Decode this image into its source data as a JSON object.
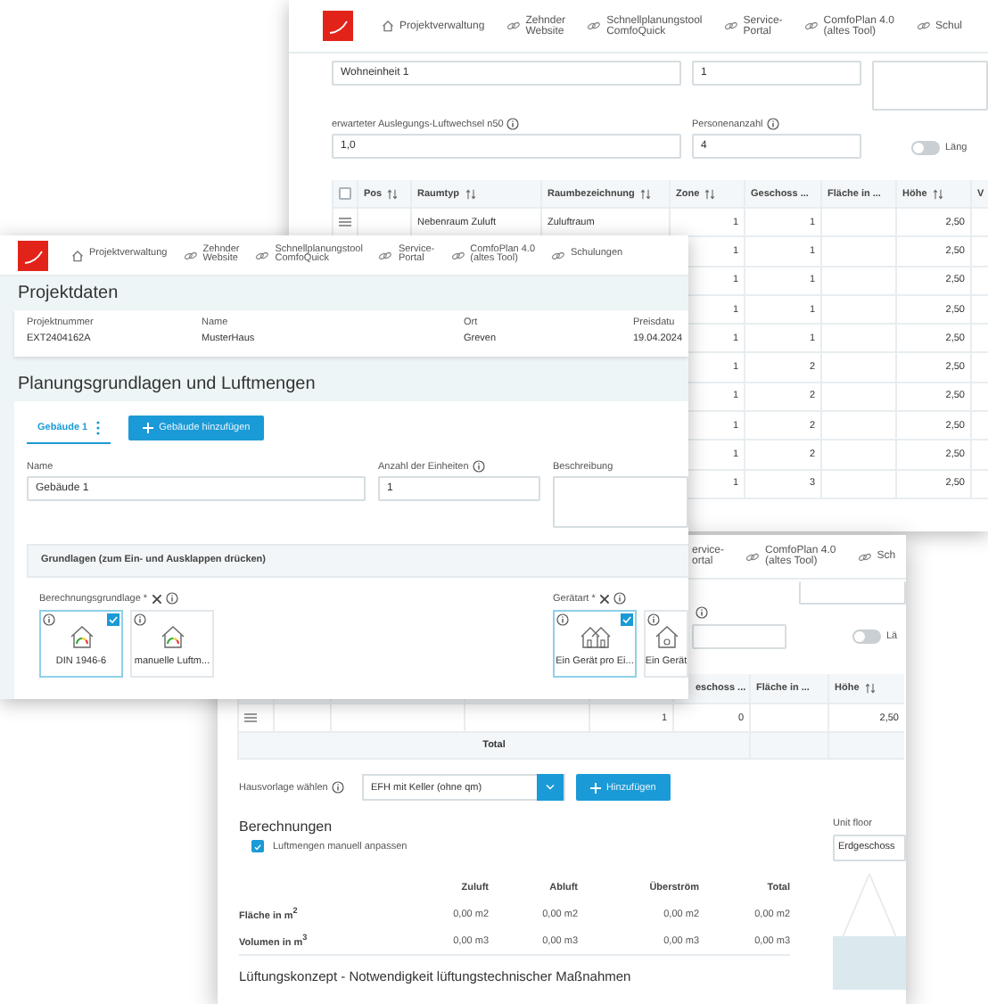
{
  "back_window": {
    "nav": [
      {
        "kind": "home",
        "label": "Projektverwaltung"
      },
      {
        "kind": "link",
        "label": "Zehnder\nWebsite"
      },
      {
        "kind": "link",
        "label": "Schnellplanungstool\nComfoQuick"
      },
      {
        "kind": "link",
        "label": "Service-\nPortal"
      },
      {
        "kind": "link",
        "label": "ComfoPlan 4.0\n(altes Tool)"
      },
      {
        "kind": "link",
        "label": "Schul"
      }
    ],
    "unit_name": {
      "value": "Wohneinheit 1"
    },
    "unit_count": {
      "value": "1"
    },
    "air_change": {
      "label": "erwarteter Auslegungs-Luftwechsel n50",
      "value": "1,0"
    },
    "persons": {
      "label": "Personenanzahl",
      "value": "4"
    },
    "toggle": {
      "label": "Läng",
      "on": false
    },
    "table": {
      "select_all": {
        "checked": false
      },
      "columns": [
        {
          "label": "Pos",
          "sortable": true
        },
        {
          "label": "Raumtyp",
          "sortable": true
        },
        {
          "label": "Raumbezeichnung",
          "sortable": true
        },
        {
          "label": "Zone",
          "sortable": true
        },
        {
          "label": "Geschoss ...",
          "sortable": false
        },
        {
          "label": "Fläche in ...",
          "sortable": false
        },
        {
          "label": "Höhe",
          "sortable": true
        },
        {
          "label": "V",
          "sortable": false
        }
      ],
      "rows": [
        {
          "handle": true,
          "raumtyp": "Nebenraum Zuluft",
          "raumbezeichnung": "Zuluftraum",
          "zone": "1",
          "geschoss": "1",
          "hoehe": "2,50"
        },
        {
          "zone": "1",
          "geschoss": "1",
          "hoehe": "2,50"
        },
        {
          "zone": "1",
          "geschoss": "1",
          "hoehe": "2,50"
        },
        {
          "zone": "1",
          "geschoss": "1",
          "hoehe": "2,50"
        },
        {
          "zone": "1",
          "geschoss": "1",
          "hoehe": "2,50"
        },
        {
          "zone": "1",
          "geschoss": "2",
          "hoehe": "2,50"
        },
        {
          "zone": "1",
          "geschoss": "2",
          "hoehe": "2,50"
        },
        {
          "zone": "1",
          "geschoss": "2",
          "hoehe": "2,50"
        },
        {
          "zone": "1",
          "geschoss": "2",
          "hoehe": "2,50"
        },
        {
          "zone": "1",
          "geschoss": "3",
          "hoehe": "2,50"
        }
      ]
    }
  },
  "bottom_window": {
    "nav": [
      {
        "kind": "none",
        "label": "ervice-\nortal"
      },
      {
        "kind": "link",
        "label": "ComfoPlan 4.0\n(altes Tool)"
      },
      {
        "kind": "link",
        "label": "Sch"
      }
    ],
    "toggle": {
      "label": "Lä",
      "on": false
    },
    "table": {
      "columns": [
        {
          "label": "eschoss ...",
          "sortable": false
        },
        {
          "label": "Fläche in ...",
          "sortable": false
        },
        {
          "label": "Höhe",
          "sortable": true
        }
      ],
      "row": {
        "zone": "1",
        "geschoss": "0",
        "hoehe": "2,50"
      },
      "total_label": "Total"
    },
    "house_template": {
      "label": "Hausvorlage wählen",
      "value": "EFH mit Keller (ohne qm)",
      "button": "Hinzufügen"
    },
    "calculations": {
      "title": "Berechnungen",
      "manual": {
        "label": "Luftmengen manuell anpassen",
        "checked": true
      },
      "columns": [
        "Zuluft",
        "Abluft",
        "Überström",
        "Total"
      ],
      "rows": [
        {
          "label": "Fläche in m$^{2}$",
          "values": [
            "0,00 m2",
            "0,00 m2",
            "0,00 m2",
            "0,00 m2"
          ]
        },
        {
          "label": "Volumen in m$^{3}$",
          "values": [
            "0,00 m3",
            "0,00 m3",
            "0,00 m3",
            "0,00 m3"
          ]
        }
      ]
    },
    "unit_floor": {
      "label": "Unit floor",
      "value": "Erdgeschoss"
    },
    "section_title": "Lüftungskonzept - Notwendigkeit lüftungstechnischer Maßnahmen"
  },
  "front_window": {
    "nav": [
      {
        "kind": "home",
        "label": "Projektverwaltung"
      },
      {
        "kind": "link",
        "label": "Zehnder\nWebsite"
      },
      {
        "kind": "link",
        "label": "Schnellplanungstool\nComfoQuick"
      },
      {
        "kind": "link",
        "label": "Service-\nPortal"
      },
      {
        "kind": "link",
        "label": "ComfoPlan 4.0\n(altes Tool)"
      },
      {
        "kind": "link",
        "label": "Schulungen"
      }
    ],
    "project_title": "Projektdaten",
    "project_fields": [
      {
        "label": "Projektnummer",
        "value": "EXT2404162A"
      },
      {
        "label": "Name",
        "value": "MusterHaus"
      },
      {
        "label": "Ort",
        "value": "Greven"
      },
      {
        "label": "Preisdatu",
        "value": "19.04.2024"
      }
    ],
    "planning_title": "Planungsgrundlagen und Luftmengen",
    "tabs": [
      {
        "label": "Gebäude 1",
        "selected": true
      }
    ],
    "add_building": "Gebäude hinzufügen",
    "fields": [
      {
        "kind": "text",
        "label": "Name",
        "value": "Gebäude 1",
        "info": false
      },
      {
        "kind": "text",
        "label": "Anzahl der Einheiten",
        "value": "1",
        "info": true
      },
      {
        "kind": "textarea",
        "label": "Beschreibung",
        "info": false
      }
    ],
    "section": {
      "title": "Grundlagen (zum Ein- und Ausklappen drücken)"
    },
    "groups": [
      {
        "label": "Berechnungsgrundlage *",
        "cards": [
          {
            "kind": "house_gauge",
            "label": "DIN 1946-6",
            "selected": true
          },
          {
            "kind": "house_gauge",
            "label": "manuelle Luftm...",
            "selected": false
          }
        ]
      },
      {
        "label": "Gerätart *",
        "cards": [
          {
            "kind": "houses",
            "label": "Ein Gerät pro Ei...",
            "selected": true
          },
          {
            "kind": "house_device",
            "label": "Ein Gerät",
            "selected": false
          }
        ]
      }
    ]
  }
}
